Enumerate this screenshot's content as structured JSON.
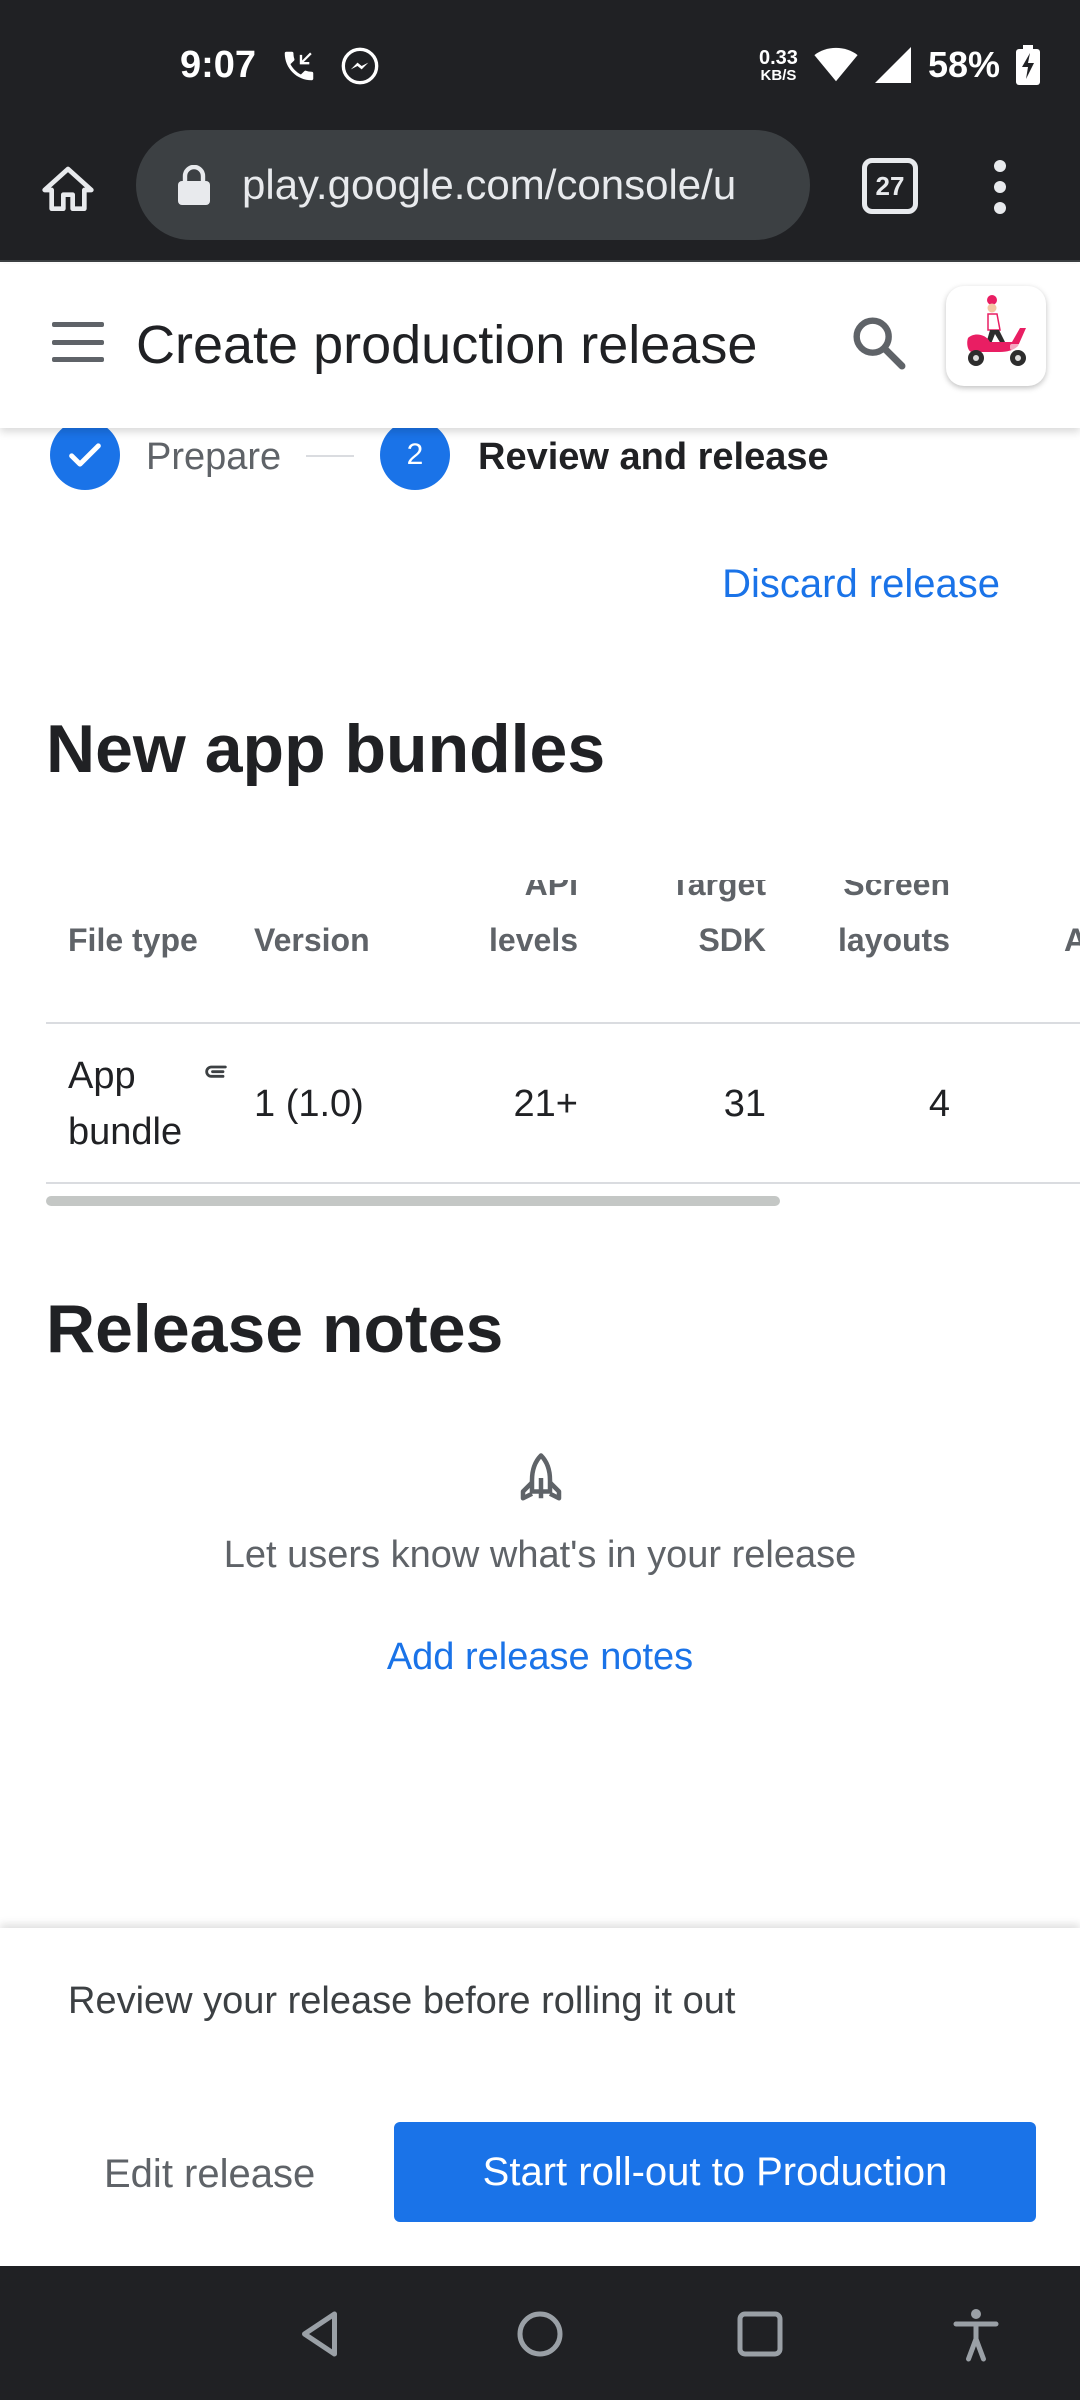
{
  "status_bar": {
    "time": "9:07",
    "net_speed_value": "0.33",
    "net_speed_unit": "KB/S",
    "battery": "58%"
  },
  "browser": {
    "url": "play.google.com/console/u",
    "tab_count": "27"
  },
  "header": {
    "title": "Create production release"
  },
  "stepper": {
    "step1_label": "Prepare",
    "step2_number": "2",
    "step2_label": "Review and release"
  },
  "discard_label": "Discard release",
  "bundles": {
    "title": "New app bundles",
    "columns": [
      {
        "line1": "",
        "line2": "File type"
      },
      {
        "line1": "",
        "line2": "Version"
      },
      {
        "line1": "API",
        "line2": "levels"
      },
      {
        "line1": "Target",
        "line2": "SDK"
      },
      {
        "line1": "Screen",
        "line2": "layouts"
      },
      {
        "line1": "",
        "line2": "A"
      }
    ],
    "rows": [
      {
        "file_type_line1": "App",
        "file_type_line2": "bundle",
        "version": "1 (1.0)",
        "api_levels": "21+",
        "target_sdk": "31",
        "screen_layouts": "4"
      }
    ]
  },
  "release_notes": {
    "title": "Release notes",
    "empty_message": "Let users know what's in your release",
    "add_label": "Add release notes"
  },
  "action_panel": {
    "review_text": "Review your release before rolling it out",
    "edit_label": "Edit release",
    "rollout_label": "Start roll-out to Production"
  },
  "colors": {
    "accent": "#1a73e8",
    "chrome_dark": "#202124"
  }
}
